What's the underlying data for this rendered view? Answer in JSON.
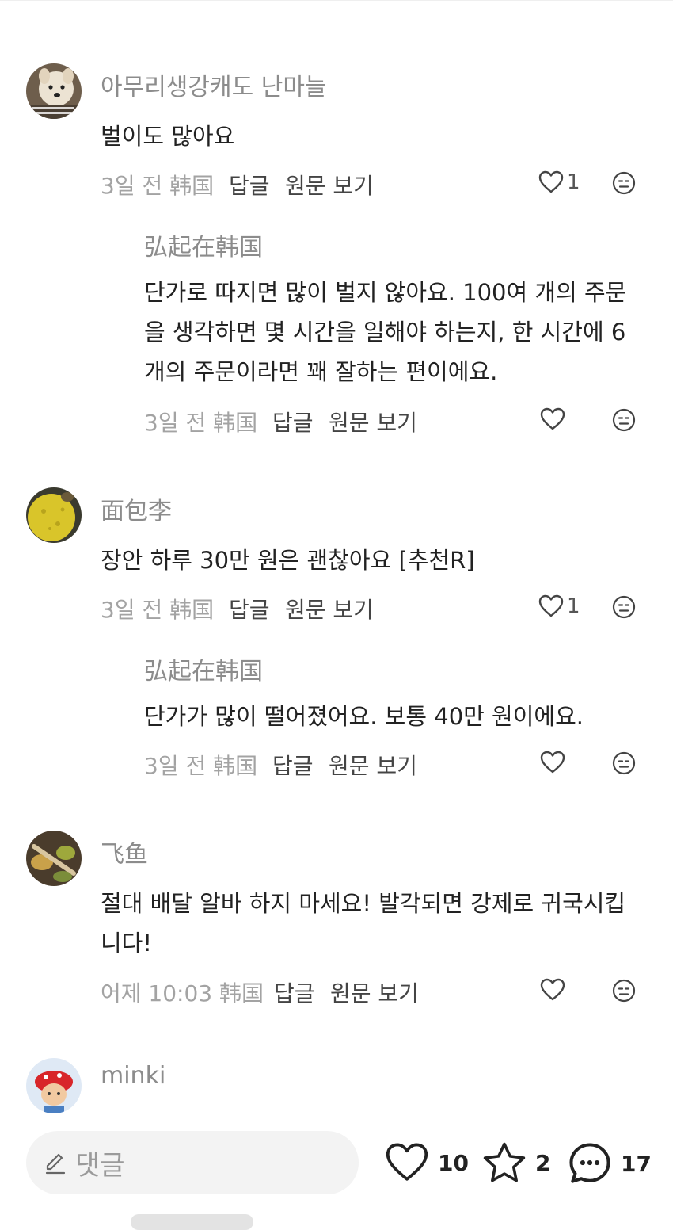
{
  "comments": [
    {
      "username": "아무리생강캐도 난마늘",
      "text_lines": [
        "벌이도 많아요"
      ],
      "time": "3일 전 韩国",
      "reply_label": "답글",
      "original_label": "원문 보기",
      "likes": "1",
      "avatar_icon": "dog-avatar",
      "reply": {
        "username": "弘起在韩国",
        "text_lines": [
          "단가로 따지면 많이 벌지 않아요. 100여 개의 주문",
          "을 생각하면 몇 시간을 일해야 하는지, 한 시간에 6",
          "개의 주문이라면 꽤 잘하는 편이에요."
        ],
        "time": "3일 전 韩国",
        "reply_label": "답글",
        "original_label": "원문 보기",
        "likes": ""
      }
    },
    {
      "username": "面包李",
      "text_lines": [
        "장안 하루 30만 원은 괜찮아요 [추천R]"
      ],
      "time": "3일 전 韩国",
      "reply_label": "답글",
      "original_label": "원문 보기",
      "likes": "1",
      "avatar_icon": "yellow-fruit-avatar",
      "reply": {
        "username": "弘起在韩国",
        "text_lines": [
          "단가가 많이 떨어졌어요. 보통 40만 원이에요."
        ],
        "time": "3일 전 韩国",
        "reply_label": "답글",
        "original_label": "원문 보기",
        "likes": ""
      }
    },
    {
      "username": "飞鱼",
      "text_lines": [
        "절대 배달 알바 하지 마세요! 발각되면 강제로 귀국시킵",
        "니다!"
      ],
      "time": "어제 10:03 韩国",
      "reply_label": "답글",
      "original_label": "원문 보기",
      "likes": "",
      "avatar_icon": "food-avatar"
    },
    {
      "username": "minki",
      "avatar_icon": "cartoon-avatar"
    }
  ],
  "bottom_bar": {
    "comment_placeholder": "댓글",
    "likes": "10",
    "favorites": "2",
    "comments": "17"
  },
  "colors": {
    "username": "#8c8c8c",
    "text": "#222222",
    "meta": "#a3a3a3",
    "link": "#444444"
  }
}
